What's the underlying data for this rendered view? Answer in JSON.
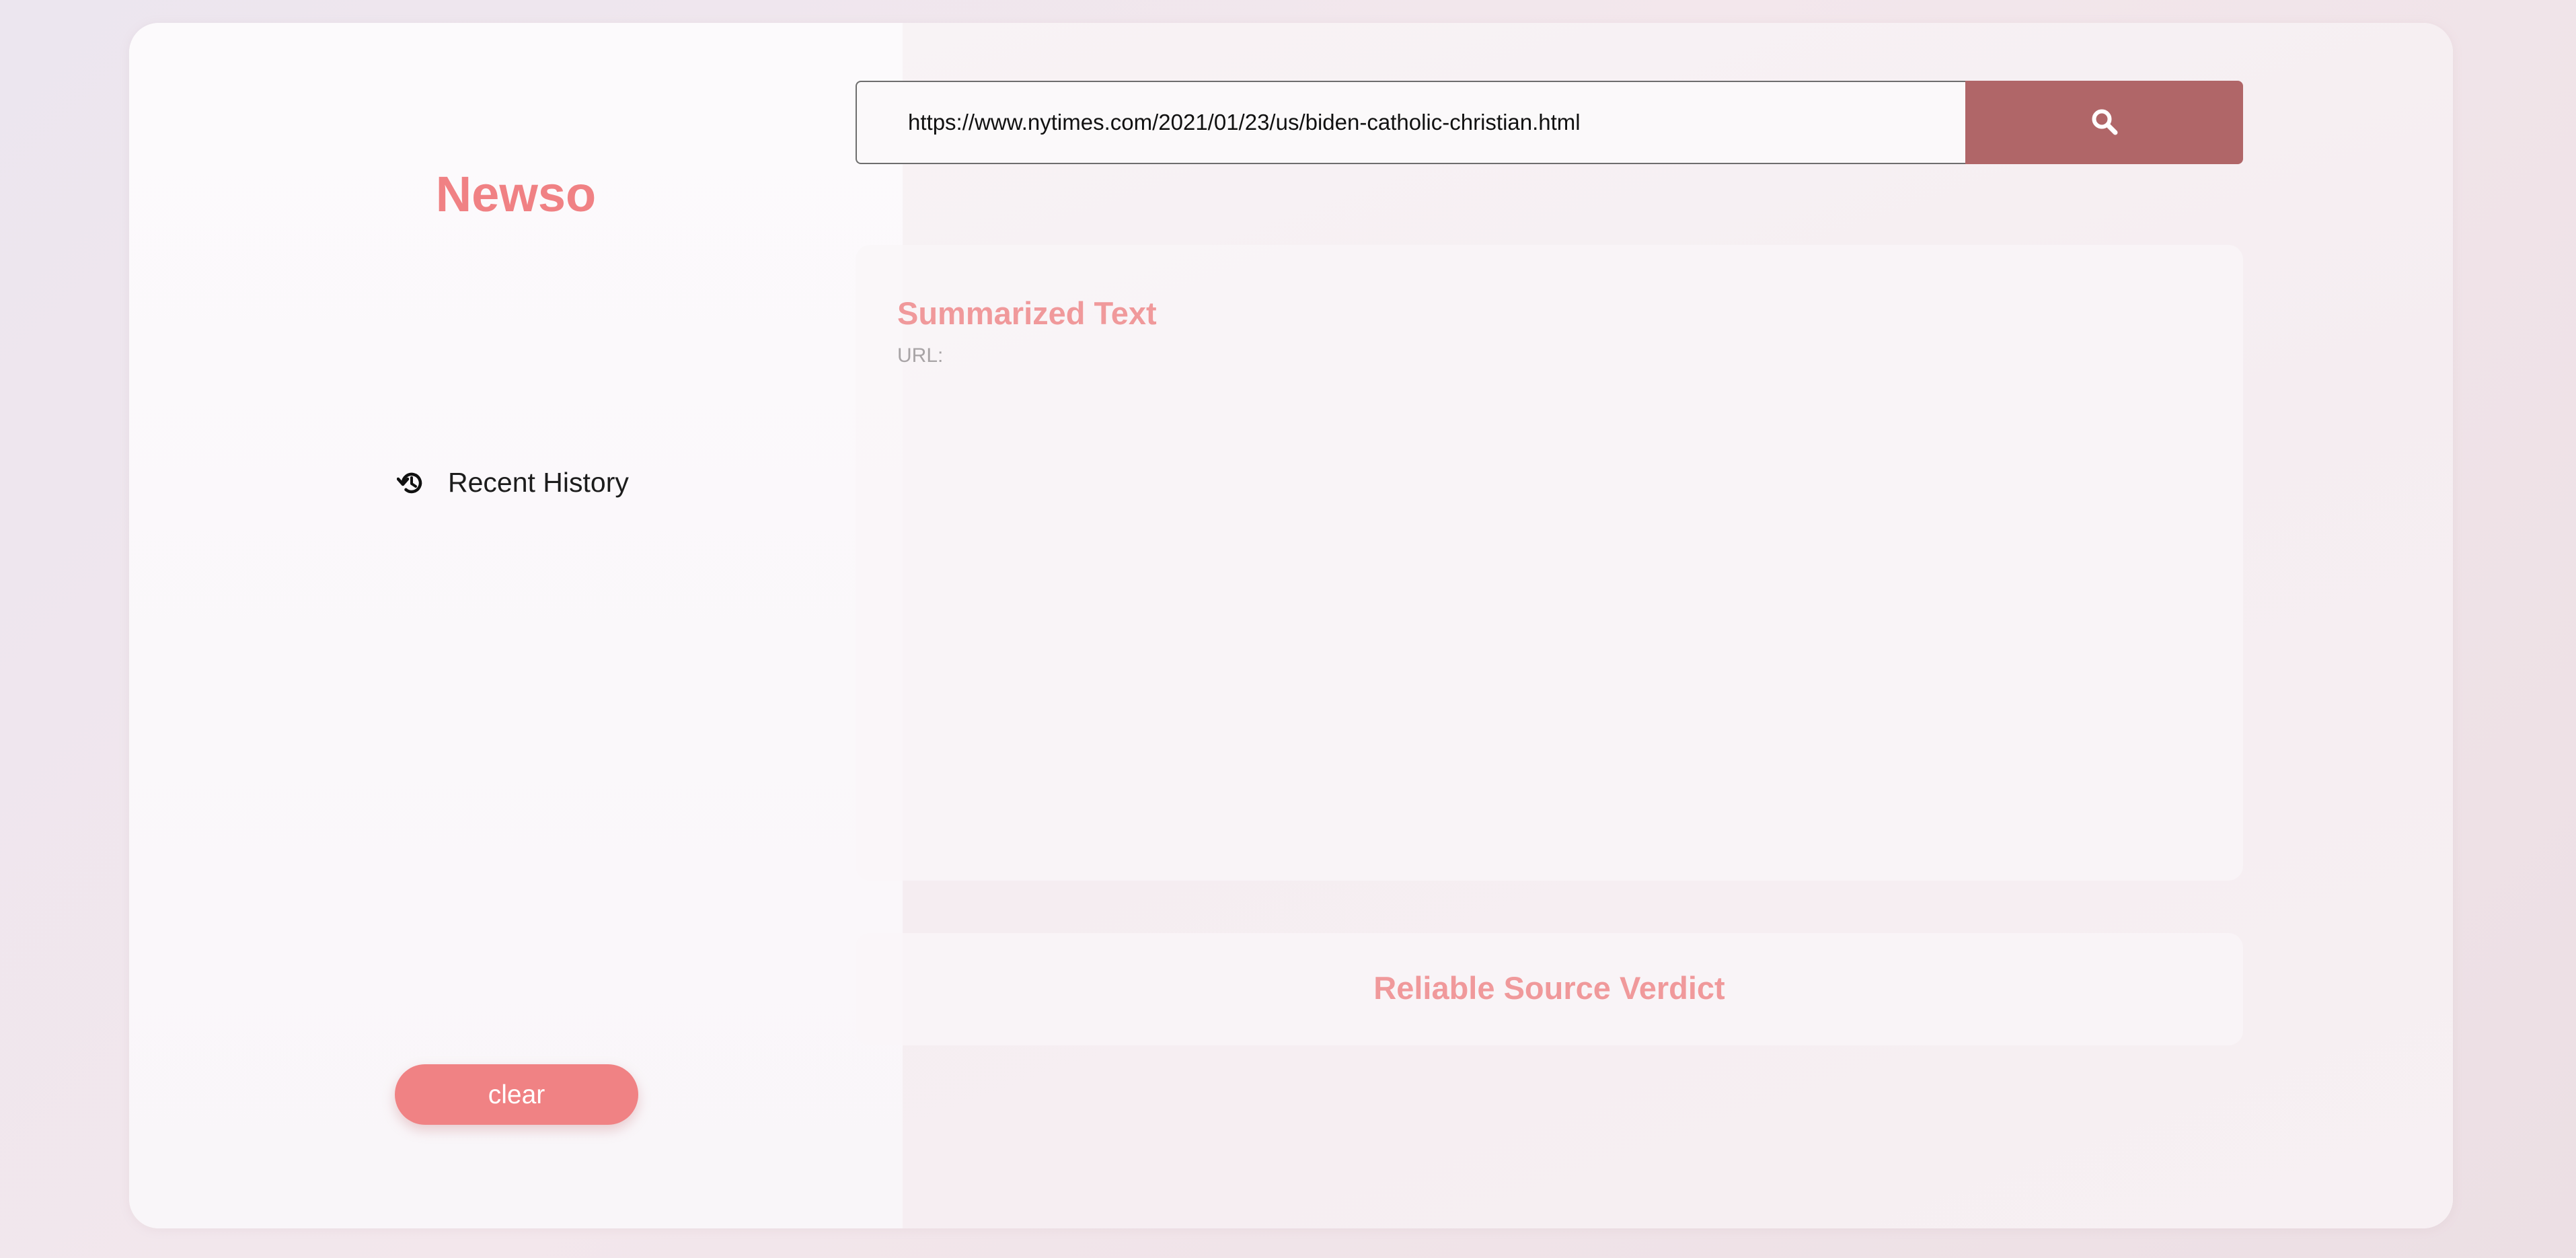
{
  "app": {
    "name": "Newso"
  },
  "sidebar": {
    "history_label": "Recent History",
    "history_icon": "history-icon",
    "clear_label": "clear"
  },
  "search": {
    "value": "https://www.nytimes.com/2021/01/23/us/biden-catholic-christian.html",
    "button_icon": "search-icon"
  },
  "summary": {
    "title": "Summarized Text",
    "url_label": "URL:"
  },
  "verdict": {
    "title": "Reliable Source Verdict"
  },
  "colors": {
    "brand": "#f08184",
    "search_button": "#b06668",
    "panel_title": "#f0999b"
  }
}
